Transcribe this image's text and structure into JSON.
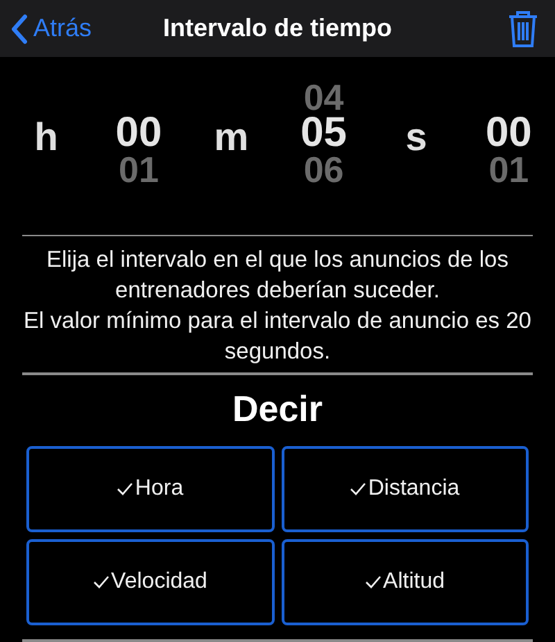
{
  "nav": {
    "back": "Atrás",
    "title": "Intervalo de tiempo"
  },
  "picker": [
    {
      "unit": "h",
      "values": [
        {
          "text": "00",
          "selected": true
        },
        {
          "text": "01",
          "selected": false
        }
      ]
    },
    {
      "unit": "m",
      "values": [
        {
          "text": "04",
          "selected": false
        },
        {
          "text": "05",
          "selected": true
        },
        {
          "text": "06",
          "selected": false
        }
      ]
    },
    {
      "unit": "s",
      "values": [
        {
          "text": "00",
          "selected": true
        },
        {
          "text": "01",
          "selected": false
        }
      ]
    }
  ],
  "description": [
    "Elija el intervalo en el que los anuncios de los entrenadores deberían suceder.",
    "El valor mínimo para el intervalo de anuncio es 20 segundos."
  ],
  "say": {
    "title": "Decir",
    "options": [
      {
        "label": "Hora",
        "checked": true
      },
      {
        "label": "Distancia",
        "checked": true
      },
      {
        "label": "Velocidad",
        "checked": true
      },
      {
        "label": "Altitud",
        "checked": true
      }
    ]
  }
}
